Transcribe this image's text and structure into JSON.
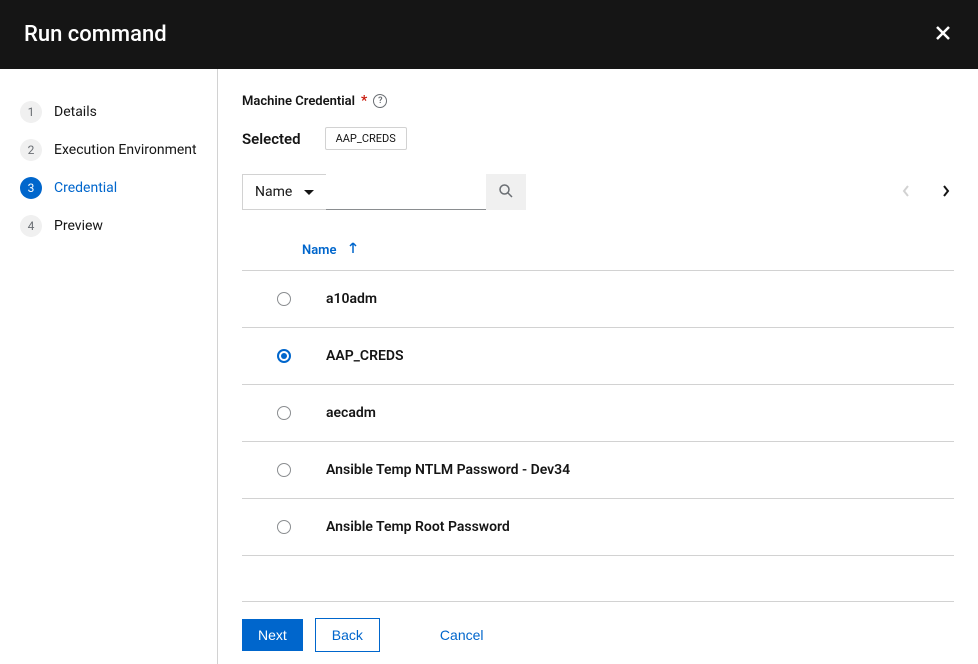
{
  "header": {
    "title": "Run command"
  },
  "sidebar": {
    "steps": [
      {
        "num": "1",
        "label": "Details",
        "active": false
      },
      {
        "num": "2",
        "label": "Execution Environment",
        "active": false
      },
      {
        "num": "3",
        "label": "Credential",
        "active": true
      },
      {
        "num": "4",
        "label": "Preview",
        "active": false
      }
    ]
  },
  "content": {
    "field_label": "Machine Credential",
    "selected_label": "Selected",
    "selected_chip": "AAP_CREDS",
    "filter_label": "Name",
    "column_name": "Name",
    "rows": [
      {
        "label": "a10adm",
        "selected": false
      },
      {
        "label": "AAP_CREDS",
        "selected": true
      },
      {
        "label": "aecadm",
        "selected": false
      },
      {
        "label": "Ansible Temp NTLM Password - Dev34",
        "selected": false
      },
      {
        "label": "Ansible Temp Root Password",
        "selected": false
      }
    ]
  },
  "footer": {
    "next": "Next",
    "back": "Back",
    "cancel": "Cancel"
  }
}
